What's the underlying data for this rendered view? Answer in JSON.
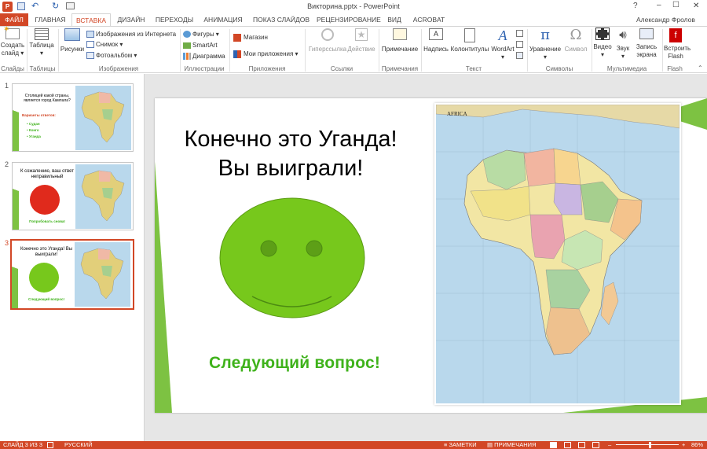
{
  "titlebar": {
    "title": "Викторина.pptx - PowerPoint",
    "help": "?",
    "minimize": "–",
    "maximize": "☐",
    "close": "✕"
  },
  "tabs": {
    "file": "ФАЙЛ",
    "home": "ГЛАВНАЯ",
    "insert": "ВСТАВКА",
    "design": "ДИЗАЙН",
    "transitions": "ПЕРЕХОДЫ",
    "animations": "АНИМАЦИЯ",
    "slideshow": "ПОКАЗ СЛАЙДОВ",
    "review": "РЕЦЕНЗИРОВАНИЕ",
    "view": "ВИД",
    "acrobat": "ACROBAT",
    "user": "Александр Фролов"
  },
  "ribbon": {
    "new_slide": [
      "Создать",
      "слайд ▾"
    ],
    "table": [
      "Таблица",
      "▾"
    ],
    "pictures": "Рисунки",
    "online_pictures": "Изображения из Интернета",
    "screenshot": "Снимок ▾",
    "photo_album": "Фотоальбом ▾",
    "shapes": "Фигуры ▾",
    "smartart": "SmartArt",
    "chart": "Диаграмма",
    "store": "Магазин",
    "my_apps": "Мои приложения ▾",
    "hyperlink": "Гиперссылка",
    "action": "Действие",
    "comment": "Примечание",
    "textbox": "Надпись",
    "header_footer": "Колонтитулы",
    "wordart": [
      "WordArt",
      "▾"
    ],
    "equation": [
      "Уравнение",
      "▾"
    ],
    "symbol": "Символ",
    "video": [
      "Видео",
      "▾"
    ],
    "audio": [
      "Звук",
      "▾"
    ],
    "screen_recording": [
      "Запись",
      "экрана"
    ],
    "flash": [
      "Встроить",
      "Flash"
    ],
    "groups": {
      "slides": "Слайды",
      "tables": "Таблицы",
      "images": "Изображения",
      "illustrations": "Иллюстрации",
      "apps": "Приложения",
      "links": "Ссылки",
      "comments": "Примечания",
      "text": "Текст",
      "symbols": "Символы",
      "media": "Мультимедиа",
      "flash": "Flash"
    }
  },
  "thumbnails": [
    {
      "num": "1",
      "title": "Столицей какой страны, является город Кампала?",
      "options_title": "Варианты ответов:",
      "options": [
        "Судан",
        "Конго",
        "Уганда"
      ]
    },
    {
      "num": "2",
      "title": "К сожалению, ваш ответ неправильный",
      "link": "Попробовать снова!"
    },
    {
      "num": "3",
      "title": "Конечно это Уганда! Вы выиграли!",
      "link": "Следующий вопрос!"
    }
  ],
  "slide": {
    "title_line1": "Конечно это Уганда!",
    "title_line2": "Вы выиграли!",
    "next_link": "Следующий вопрос!",
    "map_title": "AFRICA"
  },
  "statusbar": {
    "slide_info": "СЛАЙД 3 ИЗ 3",
    "language": "РУССКИЙ",
    "notes": "ЗАМЕТКИ",
    "comments": "ПРИМЕЧАНИЯ",
    "zoom": "86%"
  },
  "colors": {
    "accent": "#d24726",
    "green": "#7dc242",
    "smiley": "#77c81c",
    "link_green": "#3fb21b"
  }
}
